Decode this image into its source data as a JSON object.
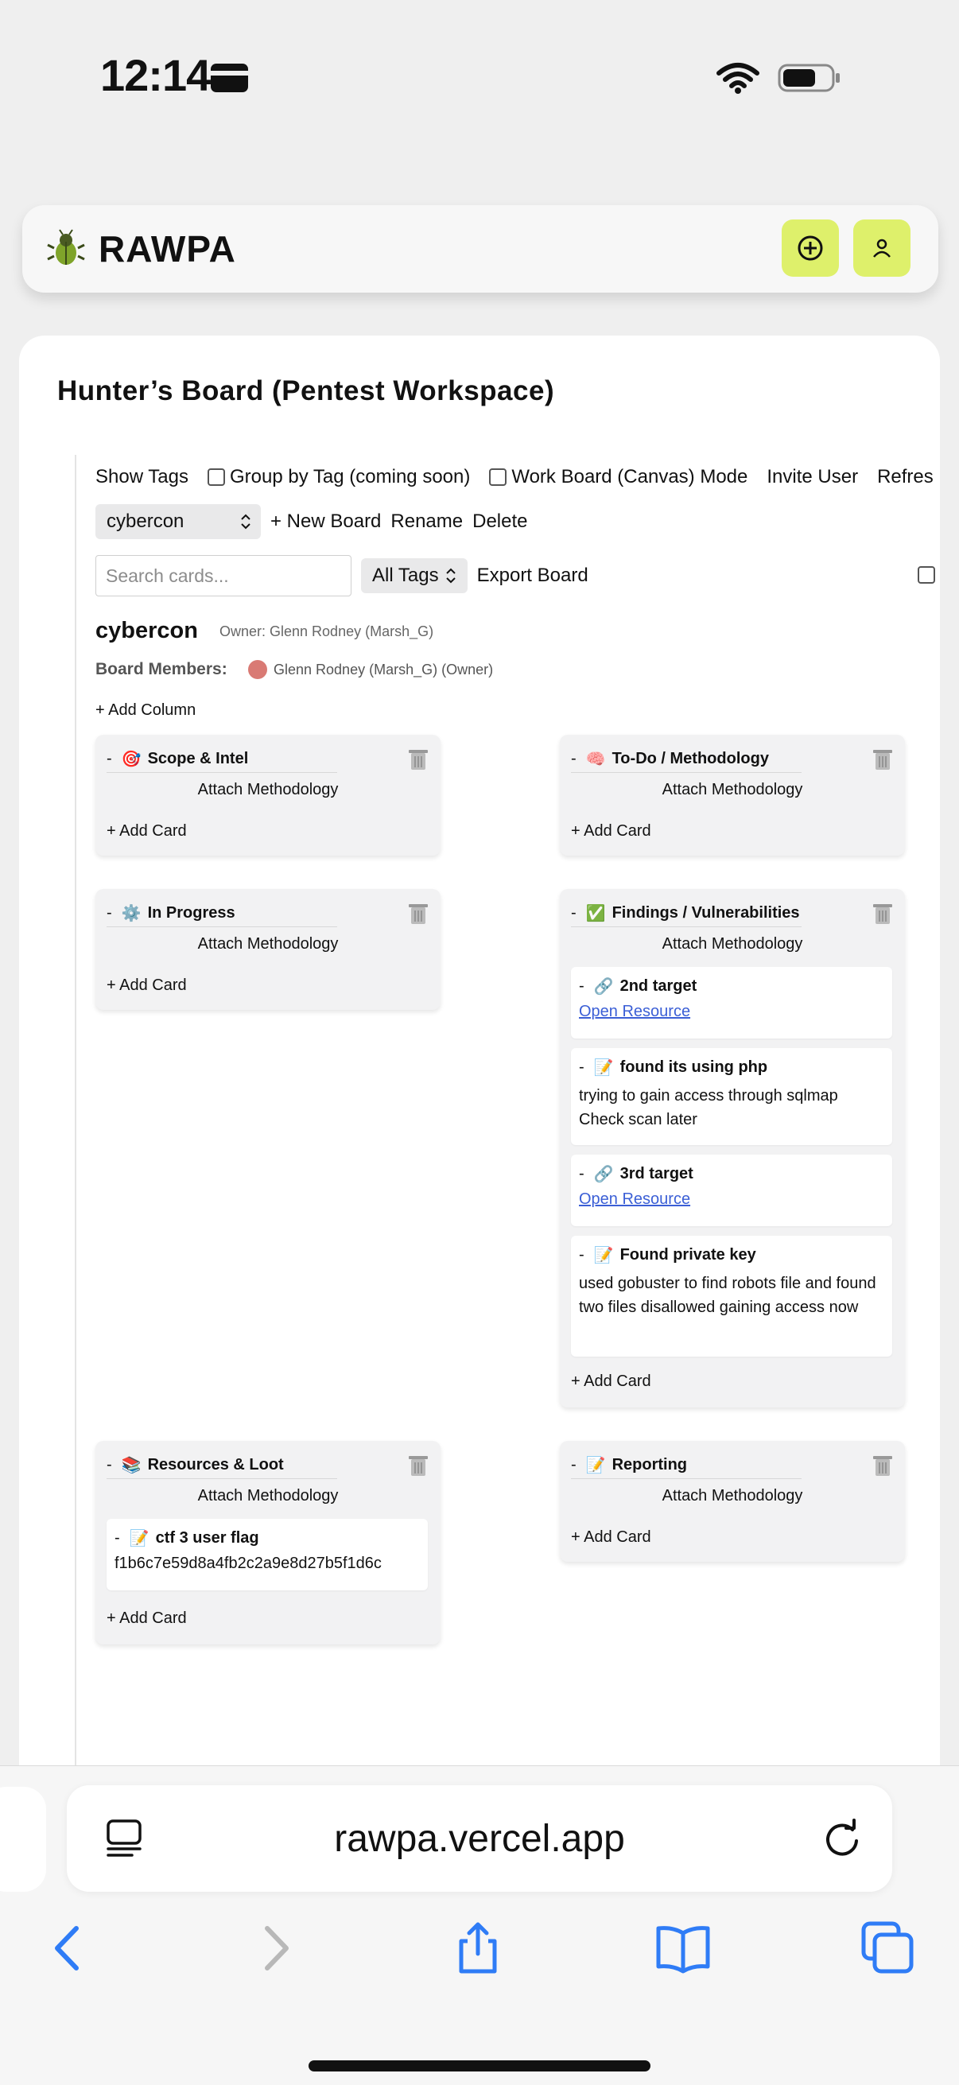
{
  "status": {
    "time": "12:14"
  },
  "header": {
    "app_title": "RAWPA",
    "icons": [
      "bug-logo-icon",
      "add-circle-icon",
      "user-icon"
    ]
  },
  "board": {
    "title": "Hunter’s Board (Pentest Workspace)",
    "toolbar": {
      "show_tags": "Show Tags",
      "group_by_tag": "Group by Tag (coming soon)",
      "work_board_mode": "Work Board (Canvas) Mode",
      "invite_user": "Invite User",
      "refresh": "Refres",
      "board_select_value": "cybercon",
      "new_board": "+ New Board",
      "rename": "Rename",
      "delete": "Delete",
      "search_placeholder": "Search cards...",
      "tags_select_value": "All Tags",
      "export_board": "Export Board"
    },
    "name": "cybercon",
    "owner": "Owner: Glenn Rodney (Marsh_G)",
    "members_label": "Board Members:",
    "member": "Glenn Rodney (Marsh_G) (Owner)",
    "add_column": "+ Add Column"
  },
  "columns": [
    {
      "dash": "-",
      "emoji": "🎯",
      "title": "Scope & Intel",
      "attach": "Attach Methodology",
      "add_card": "+ Add Card"
    },
    {
      "dash": "-",
      "emoji": "🧠",
      "title": "To-Do / Methodology",
      "attach": "Attach Methodology",
      "add_card": "+ Add Card"
    },
    {
      "dash": "-",
      "emoji": "⚙️",
      "title": "In Progress",
      "attach": "Attach Methodology",
      "add_card": "+ Add Card"
    },
    {
      "dash": "-",
      "emoji": "✅",
      "title": "Findings / Vulnerabilities",
      "attach": "Attach Methodology",
      "add_card": "+ Add Card",
      "cards": [
        {
          "dash": "-",
          "emoji": "🔗",
          "title": "2nd target",
          "link": "Open Resource"
        },
        {
          "dash": "-",
          "emoji": "📝",
          "title": "found its using php",
          "body": "trying to gain access through sqlmap Check scan later"
        },
        {
          "dash": "-",
          "emoji": "🔗",
          "title": "3rd target",
          "link": "Open Resource"
        },
        {
          "dash": "-",
          "emoji": "📝",
          "title": "Found private key",
          "body": "used gobuster to find robots file and found two files disallowed gaining access now"
        }
      ]
    },
    {
      "dash": "-",
      "emoji": "📚",
      "title": "Resources & Loot",
      "attach": "Attach Methodology",
      "add_card": "+ Add Card",
      "cards": [
        {
          "dash": "-",
          "emoji": "📝",
          "title": "ctf 3 user flag",
          "body": "f1b6c7e59d8a4fb2c2a9e8d27b5f1d6c"
        }
      ]
    },
    {
      "dash": "-",
      "emoji": "📝",
      "title": "Reporting",
      "attach": "Attach Methodology",
      "add_card": "+ Add Card"
    }
  ],
  "browser": {
    "url": "rawpa.vercel.app"
  },
  "colors": {
    "accent": "#def06b",
    "link": "#3b5fd6",
    "member_dot": "#d97a74"
  }
}
